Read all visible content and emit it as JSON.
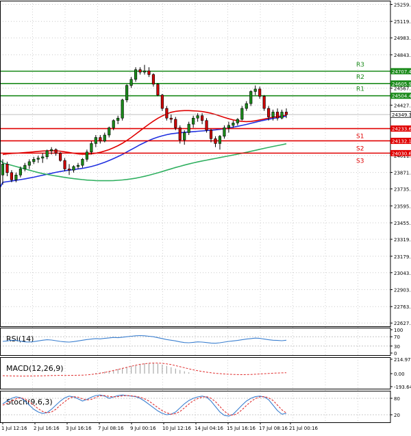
{
  "chart_data": [
    {
      "type": "candlestick",
      "panel": "price",
      "y_ticks": [
        25259.0,
        25119.0,
        24983.0,
        24843.0,
        24707.4,
        24605.9,
        24567.0,
        24504.4,
        24427.0,
        24349.3,
        24233.6,
        24132.1,
        24030.6,
        24011.0,
        23871.0,
        23735.0,
        23595.0,
        23455.0,
        23319.0,
        23179.0,
        23043.0,
        22903.0,
        22763.0,
        22627.0
      ],
      "current_price": 24349.3,
      "x_tick_labels": [
        "1 Jul 12:16",
        "2 Jul 16:16",
        "3 Jul 16:16",
        "7 Jul 08:16",
        "9 Jul 00:16",
        "10 Jul 12:16",
        "14 Jul 04:16",
        "15 Jul 16:16",
        "17 Jul 08:16",
        "21 Jul 00:16"
      ],
      "levels": [
        {
          "name": "R3",
          "value": 24707.4,
          "color": "#1a8a1a"
        },
        {
          "name": "R2",
          "value": 24605.9,
          "color": "#1a8a1a"
        },
        {
          "name": "R1",
          "value": 24504.4,
          "color": "#1a8a1a"
        },
        {
          "name": "S1",
          "value": 24233.6,
          "color": "#e00000"
        },
        {
          "name": "S2",
          "value": 24132.1,
          "color": "#e00000"
        },
        {
          "name": "S3",
          "value": 24030.6,
          "color": "#e00000"
        }
      ],
      "ylim": [
        22600,
        25290
      ],
      "bullish_color": "#1a8a1a",
      "bearish_color": "#cc0000",
      "candles": [
        {
          "o": 23850,
          "h": 23980,
          "l": 23770,
          "c": 23940
        },
        {
          "o": 23940,
          "h": 23960,
          "l": 23840,
          "c": 23870
        },
        {
          "o": 23870,
          "h": 23890,
          "l": 23790,
          "c": 23810
        },
        {
          "o": 23810,
          "h": 23870,
          "l": 23790,
          "c": 23850
        },
        {
          "o": 23850,
          "h": 23920,
          "l": 23830,
          "c": 23900
        },
        {
          "o": 23900,
          "h": 23950,
          "l": 23880,
          "c": 23930
        },
        {
          "o": 23930,
          "h": 23980,
          "l": 23900,
          "c": 23960
        },
        {
          "o": 23960,
          "h": 24000,
          "l": 23940,
          "c": 23980
        },
        {
          "o": 23980,
          "h": 24010,
          "l": 23950,
          "c": 23990
        },
        {
          "o": 23990,
          "h": 24030,
          "l": 23950,
          "c": 24000
        },
        {
          "o": 24000,
          "h": 24060,
          "l": 23980,
          "c": 24050
        },
        {
          "o": 24050,
          "h": 24080,
          "l": 24020,
          "c": 24060
        },
        {
          "o": 24060,
          "h": 24070,
          "l": 24010,
          "c": 24030
        },
        {
          "o": 24030,
          "h": 24040,
          "l": 23960,
          "c": 23970
        },
        {
          "o": 23970,
          "h": 23990,
          "l": 23880,
          "c": 23900
        },
        {
          "o": 23900,
          "h": 23940,
          "l": 23850,
          "c": 23890
        },
        {
          "o": 23890,
          "h": 23930,
          "l": 23870,
          "c": 23920
        },
        {
          "o": 23920,
          "h": 23950,
          "l": 23900,
          "c": 23930
        },
        {
          "o": 23930,
          "h": 23990,
          "l": 23910,
          "c": 23980
        },
        {
          "o": 23980,
          "h": 24060,
          "l": 23960,
          "c": 24040
        },
        {
          "o": 24040,
          "h": 24130,
          "l": 24020,
          "c": 24110
        },
        {
          "o": 24110,
          "h": 24180,
          "l": 24080,
          "c": 24160
        },
        {
          "o": 24160,
          "h": 24180,
          "l": 24110,
          "c": 24130
        },
        {
          "o": 24130,
          "h": 24200,
          "l": 24120,
          "c": 24180
        },
        {
          "o": 24180,
          "h": 24250,
          "l": 24160,
          "c": 24240
        },
        {
          "o": 24240,
          "h": 24310,
          "l": 24220,
          "c": 24300
        },
        {
          "o": 24300,
          "h": 24340,
          "l": 24270,
          "c": 24320
        },
        {
          "o": 24320,
          "h": 24480,
          "l": 24300,
          "c": 24470
        },
        {
          "o": 24470,
          "h": 24600,
          "l": 24450,
          "c": 24590
        },
        {
          "o": 24590,
          "h": 24660,
          "l": 24570,
          "c": 24640
        },
        {
          "o": 24640,
          "h": 24740,
          "l": 24620,
          "c": 24720
        },
        {
          "o": 24720,
          "h": 24740,
          "l": 24680,
          "c": 24700
        },
        {
          "o": 24700,
          "h": 24760,
          "l": 24680,
          "c": 24710
        },
        {
          "o": 24710,
          "h": 24740,
          "l": 24660,
          "c": 24680
        },
        {
          "o": 24680,
          "h": 24690,
          "l": 24580,
          "c": 24600
        },
        {
          "o": 24600,
          "h": 24610,
          "l": 24500,
          "c": 24510
        },
        {
          "o": 24510,
          "h": 24520,
          "l": 24380,
          "c": 24400
        },
        {
          "o": 24400,
          "h": 24420,
          "l": 24300,
          "c": 24320
        },
        {
          "o": 24320,
          "h": 24350,
          "l": 24280,
          "c": 24310
        },
        {
          "o": 24310,
          "h": 24330,
          "l": 24220,
          "c": 24240
        },
        {
          "o": 24240,
          "h": 24260,
          "l": 24110,
          "c": 24140
        },
        {
          "o": 24140,
          "h": 24220,
          "l": 24100,
          "c": 24200
        },
        {
          "o": 24200,
          "h": 24290,
          "l": 24180,
          "c": 24270
        },
        {
          "o": 24270,
          "h": 24340,
          "l": 24240,
          "c": 24320
        },
        {
          "o": 24320,
          "h": 24360,
          "l": 24290,
          "c": 24340
        },
        {
          "o": 24340,
          "h": 24360,
          "l": 24270,
          "c": 24300
        },
        {
          "o": 24300,
          "h": 24320,
          "l": 24200,
          "c": 24220
        },
        {
          "o": 24220,
          "h": 24230,
          "l": 24120,
          "c": 24150
        },
        {
          "o": 24150,
          "h": 24170,
          "l": 24080,
          "c": 24110
        },
        {
          "o": 24110,
          "h": 24180,
          "l": 24060,
          "c": 24170
        },
        {
          "o": 24170,
          "h": 24260,
          "l": 24150,
          "c": 24240
        },
        {
          "o": 24240,
          "h": 24290,
          "l": 24200,
          "c": 24260
        },
        {
          "o": 24260,
          "h": 24300,
          "l": 24240,
          "c": 24280
        },
        {
          "o": 24280,
          "h": 24320,
          "l": 24260,
          "c": 24310
        },
        {
          "o": 24310,
          "h": 24420,
          "l": 24300,
          "c": 24400
        },
        {
          "o": 24400,
          "h": 24460,
          "l": 24380,
          "c": 24440
        },
        {
          "o": 24440,
          "h": 24550,
          "l": 24420,
          "c": 24540
        },
        {
          "o": 24540,
          "h": 24590,
          "l": 24510,
          "c": 24560
        },
        {
          "o": 24560,
          "h": 24580,
          "l": 24480,
          "c": 24500
        },
        {
          "o": 24500,
          "h": 24510,
          "l": 24380,
          "c": 24400
        },
        {
          "o": 24400,
          "h": 24420,
          "l": 24300,
          "c": 24330
        },
        {
          "o": 24330,
          "h": 24390,
          "l": 24300,
          "c": 24370
        },
        {
          "o": 24370,
          "h": 24400,
          "l": 24300,
          "c": 24320
        },
        {
          "o": 24320,
          "h": 24390,
          "l": 24310,
          "c": 24370
        },
        {
          "o": 24370,
          "h": 24400,
          "l": 24320,
          "c": 24349
        }
      ],
      "moving_averages": [
        {
          "color": "#e00000",
          "values": [
            24020,
            24025,
            24028,
            24030,
            24032,
            24035,
            24038,
            24042,
            24045,
            24048,
            24050,
            24051,
            24050,
            24047,
            24042,
            24036,
            24030,
            24025,
            24022,
            24022,
            24025,
            24030,
            24038,
            24048,
            24060,
            24075,
            24092,
            24112,
            24135,
            24160,
            24188,
            24215,
            24243,
            24270,
            24295,
            24318,
            24338,
            24355,
            24368,
            24376,
            24380,
            24382,
            24382,
            24380,
            24378,
            24374,
            24368,
            24360,
            24350,
            24338,
            24326,
            24315,
            24305,
            24298,
            24293,
            24291,
            24293,
            24298,
            24305,
            24312,
            24320,
            24327,
            24333,
            24338,
            24342
          ]
        },
        {
          "color": "#2030e0",
          "values": [
            23790,
            23795,
            23800,
            23806,
            23812,
            23818,
            23825,
            23832,
            23840,
            23848,
            23856,
            23864,
            23872,
            23879,
            23885,
            23890,
            23895,
            23900,
            23905,
            23912,
            23920,
            23930,
            23942,
            23955,
            23970,
            23985,
            24002,
            24020,
            24040,
            24060,
            24080,
            24100,
            24118,
            24135,
            24150,
            24163,
            24174,
            24183,
            24190,
            24195,
            24199,
            24202,
            24205,
            24208,
            24211,
            24214,
            24217,
            24220,
            24223,
            24227,
            24232,
            24238,
            24245,
            24252,
            24260,
            24268,
            24277,
            24286,
            24295,
            24303,
            24310,
            24317,
            24324,
            24330,
            24336
          ]
        },
        {
          "color": "#30b060",
          "values": [
            23950,
            23940,
            23930,
            23920,
            23910,
            23900,
            23890,
            23880,
            23870,
            23862,
            23855,
            23848,
            23842,
            23836,
            23830,
            23825,
            23820,
            23816,
            23812,
            23808,
            23806,
            23804,
            23803,
            23803,
            23803,
            23804,
            23806,
            23809,
            23813,
            23818,
            23824,
            23831,
            23839,
            23848,
            23858,
            23868,
            23879,
            23890,
            23901,
            23912,
            23922,
            23932,
            23941,
            23950,
            23958,
            23966,
            23973,
            23980,
            23987,
            23994,
            24001,
            24008,
            24015,
            24022,
            24030,
            24038,
            24046,
            24054,
            24062,
            24070,
            24078,
            24086,
            24093,
            24100,
            24108
          ]
        }
      ]
    },
    {
      "type": "line",
      "panel": "indicator",
      "title": "RSI(14)",
      "y_ticks": [
        "100",
        "70",
        "30",
        "0"
      ],
      "ylim": [
        0,
        100
      ],
      "series": [
        {
          "color": "#3a7fd0",
          "values": [
            50,
            52,
            55,
            54,
            51,
            48,
            47,
            49,
            52,
            55,
            57,
            56,
            53,
            50,
            48,
            47,
            49,
            52,
            55,
            58,
            60,
            62,
            61,
            63,
            65,
            67,
            66,
            68,
            70,
            72,
            74,
            75,
            74,
            72,
            70,
            66,
            62,
            58,
            55,
            52,
            48,
            45,
            44,
            46,
            48,
            47,
            45,
            43,
            42,
            44,
            47,
            50,
            52,
            54,
            57,
            60,
            62,
            64,
            63,
            60,
            57,
            55,
            54,
            53,
            55
          ]
        }
      ]
    },
    {
      "type": "bar",
      "panel": "indicator",
      "title": "MACD(12,26,9)",
      "y_ticks": [
        "214.97",
        "0.00",
        "-193.64"
      ],
      "ylim": [
        -193.64,
        214.97
      ],
      "series": [
        {
          "name": "histogram",
          "color": "#999999",
          "values": [
            0,
            0,
            0,
            0,
            0,
            0,
            0,
            0,
            0,
            0,
            0,
            0,
            0,
            0,
            0,
            0,
            0,
            0,
            0,
            0,
            0,
            10,
            20,
            30,
            40,
            55,
            70,
            85,
            100,
            115,
            130,
            145,
            155,
            160,
            158,
            150,
            135,
            115,
            95,
            75,
            55,
            35,
            20,
            5,
            0,
            0,
            0,
            0,
            0,
            0,
            0,
            0,
            0,
            0,
            0,
            0,
            0,
            0,
            0,
            0,
            0,
            0,
            0,
            0,
            0
          ]
        },
        {
          "name": "signal",
          "color": "#e03030",
          "values": [
            -30,
            -32,
            -34,
            -35,
            -36,
            -36,
            -35,
            -34,
            -33,
            -32,
            -30,
            -28,
            -27,
            -26,
            -26,
            -26,
            -25,
            -24,
            -22,
            -18,
            -12,
            -4,
            6,
            18,
            32,
            46,
            62,
            78,
            94,
            110,
            125,
            138,
            148,
            155,
            158,
            158,
            154,
            146,
            135,
            120,
            104,
            88,
            72,
            57,
            44,
            32,
            22,
            13,
            6,
            0,
            -5,
            -9,
            -12,
            -14,
            -15,
            -14,
            -12,
            -9,
            -5,
            -1,
            3,
            7,
            10,
            12,
            14
          ]
        }
      ]
    },
    {
      "type": "line",
      "panel": "indicator",
      "title": "Stoch(9,6,3)",
      "y_ticks": [
        "80",
        "20"
      ],
      "ylim": [
        0,
        100
      ],
      "series": [
        {
          "name": "main",
          "color": "#3a7fd0",
          "values": [
            60,
            70,
            80,
            85,
            82,
            70,
            55,
            40,
            30,
            25,
            28,
            40,
            55,
            70,
            82,
            88,
            85,
            78,
            70,
            76,
            84,
            90,
            92,
            88,
            80,
            85,
            90,
            92,
            90,
            88,
            86,
            80,
            70,
            58,
            46,
            34,
            25,
            20,
            22,
            30,
            45,
            60,
            72,
            80,
            85,
            88,
            84,
            70,
            50,
            30,
            18,
            15,
            22,
            38,
            55,
            70,
            80,
            86,
            88,
            85,
            75,
            55,
            35,
            22,
            25
          ]
        },
        {
          "name": "signal",
          "color": "#e03030",
          "values": [
            55,
            62,
            70,
            78,
            82,
            78,
            68,
            55,
            42,
            32,
            27,
            30,
            40,
            55,
            68,
            80,
            86,
            84,
            78,
            74,
            76,
            83,
            89,
            90,
            87,
            85,
            86,
            89,
            90,
            89,
            87,
            84,
            78,
            70,
            58,
            46,
            35,
            27,
            22,
            24,
            32,
            45,
            59,
            71,
            79,
            84,
            86,
            80,
            68,
            50,
            33,
            21,
            18,
            25,
            38,
            54,
            68,
            79,
            85,
            86,
            82,
            72,
            55,
            38,
            26
          ]
        }
      ]
    }
  ]
}
